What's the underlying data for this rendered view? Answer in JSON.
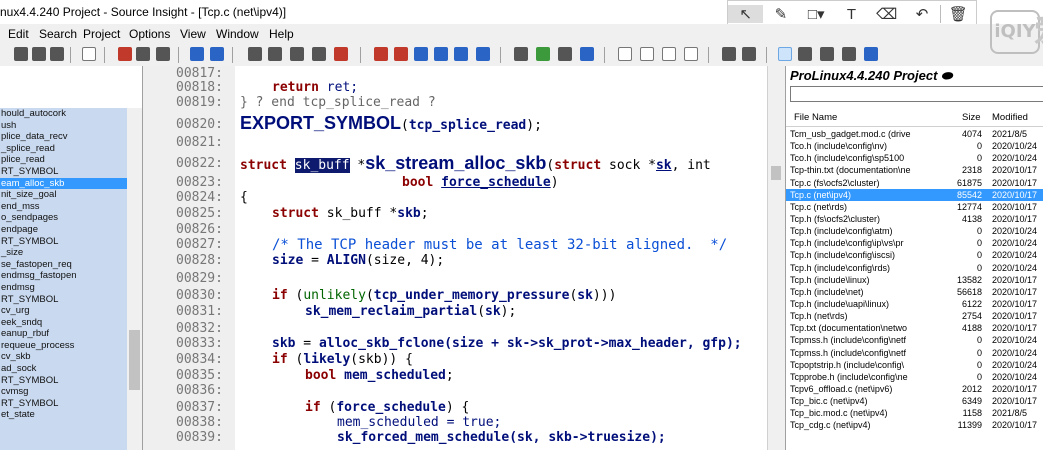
{
  "window": {
    "title": "nux4.4.240 Project - Source Insight - [Tcp.c (net\\ipv4)]"
  },
  "overlay_toolbar": {
    "icons": [
      "cursor-icon",
      "pen-icon",
      "rect-icon",
      "text-icon",
      "eraser-icon",
      "undo-icon",
      "trash-icon"
    ]
  },
  "watermark": {
    "text": "iQIY",
    "char": "爱"
  },
  "menu": {
    "items": [
      "Edit",
      "Search",
      "Project",
      "Options",
      "View",
      "Window",
      "Help"
    ]
  },
  "symbols": {
    "items": [
      "hould_autocork",
      "ush",
      "plice_data_recv",
      "_splice_read",
      "plice_read",
      "RT_SYMBOL",
      "eam_alloc_skb",
      "nit_size_goal",
      "end_mss",
      "o_sendpages",
      "endpage",
      "RT_SYMBOL",
      "_size",
      "se_fastopen_req",
      "endmsg_fastopen",
      "endmsg",
      "RT_SYMBOL",
      "cv_urg",
      "eek_sndq",
      "eanup_rbuf",
      "requeue_process",
      "cv_skb",
      "ad_sock",
      "RT_SYMBOL",
      "cvmsg",
      "RT_SYMBOL",
      "et_state"
    ],
    "selected_index": 6
  },
  "editor": {
    "line_numbers": [
      "00817:",
      "00818:",
      "00819:",
      "00820:",
      "00821:",
      "00822:",
      "00823:",
      "00824:",
      "00825:",
      "00826:",
      "00827:",
      "00828:",
      "00829:",
      "00830:",
      "00831:",
      "00832:",
      "00833:",
      "00834:",
      "00835:",
      "00836:",
      "00837:",
      "00838:",
      "00839:"
    ],
    "l818": {
      "kw": "return",
      "rest": " ret;"
    },
    "l819": {
      "text": "} ? end tcp_splice_read ?"
    },
    "l820": {
      "fn": "EXPORT_SYMBOL",
      "p1": "(",
      "arg": "tcp_splice_read",
      "p2": ");"
    },
    "l822": {
      "kw": "struct",
      "hl": "sk_buff",
      "star": " *",
      "fn": "sk_stream_alloc_skb",
      "p1": "(",
      "kw2": "struct",
      "sock": " sock *",
      "sk": "sk",
      "rest": ", int"
    },
    "l823": {
      "kw": "bool",
      "arg": "force_schedule",
      "p": ")"
    },
    "l824": {
      "text": "{"
    },
    "l825": {
      "kw": "struct",
      "rest": " sk_buff *",
      "id": "skb",
      "semi": ";"
    },
    "l827": {
      "text": "/* The TCP header must be at least 32-bit aligned.  */"
    },
    "l828": {
      "id": "size",
      "eq": " = ",
      "pr": "ALIGN",
      "args": "(size, 4);"
    },
    "l830": {
      "kw": "if",
      "p1": " (",
      "pr": "unlikely",
      "p2": "(",
      "fn": "tcp_under_memory_pressure",
      "args": "(",
      "sk": "sk",
      "end": ")))"
    },
    "l831": {
      "fn": "sk_mem_reclaim_partial",
      "p": "(",
      "sk": "sk",
      "end": ");"
    },
    "l833": {
      "id": "skb",
      "eq": " = ",
      "fn": "alloc_skb_fclone",
      "args": "(size + sk->sk_prot->max_header, gfp);"
    },
    "l834": {
      "kw": "if",
      "p1": " (",
      "pr": "likely",
      "args": "(skb)) {"
    },
    "l835": {
      "kw": "bool",
      "id": " mem_scheduled",
      "semi": ";"
    },
    "l837": {
      "kw": "if",
      "p1": " (",
      "id": "force_schedule",
      "end": ") {"
    },
    "l838": {
      "text": "mem_scheduled = true;"
    },
    "l839": {
      "fn": "sk_forced_mem_schedule",
      "args": "(sk, skb->truesize);"
    }
  },
  "project": {
    "title": "ProLinux4.4.240 Project",
    "columns": [
      "File Name",
      "Size",
      "Modified"
    ],
    "selected_index": 6,
    "files": [
      {
        "name": "Tcm_usb_gadget.mod.c (drive",
        "size": "4074",
        "date": "2021/8/5"
      },
      {
        "name": "Tco.h (include\\config\\nv)",
        "size": "0",
        "date": "2020/10/24"
      },
      {
        "name": "Tco.h (include\\config\\sp5100",
        "size": "0",
        "date": "2020/10/24"
      },
      {
        "name": "Tcp-thin.txt (documentation\\ne",
        "size": "2318",
        "date": "2020/10/17"
      },
      {
        "name": "Tcp.c (fs\\ocfs2\\cluster)",
        "size": "61875",
        "date": "2020/10/17"
      },
      {
        "name": "Tcp.c (net\\ipv4)",
        "size": "85542",
        "date": "2020/10/17"
      },
      {
        "name": "Tcp.c (net\\rds)",
        "size": "12774",
        "date": "2020/10/17"
      },
      {
        "name": "Tcp.h (fs\\ocfs2\\cluster)",
        "size": "4138",
        "date": "2020/10/17"
      },
      {
        "name": "Tcp.h (include\\config\\atm)",
        "size": "0",
        "date": "2020/10/24"
      },
      {
        "name": "Tcp.h (include\\config\\ip\\vs\\pr",
        "size": "0",
        "date": "2020/10/24"
      },
      {
        "name": "Tcp.h (include\\config\\iscsi)",
        "size": "0",
        "date": "2020/10/24"
      },
      {
        "name": "Tcp.h (include\\config\\rds)",
        "size": "0",
        "date": "2020/10/24"
      },
      {
        "name": "Tcp.h (include\\linux)",
        "size": "13582",
        "date": "2020/10/17"
      },
      {
        "name": "Tcp.h (include\\net)",
        "size": "56618",
        "date": "2020/10/17"
      },
      {
        "name": "Tcp.h (include\\uapi\\linux)",
        "size": "6122",
        "date": "2020/10/17"
      },
      {
        "name": "Tcp.h (net\\rds)",
        "size": "2754",
        "date": "2020/10/17"
      },
      {
        "name": "Tcp.txt (documentation\\netwo",
        "size": "4188",
        "date": "2020/10/17"
      },
      {
        "name": "Tcpmss.h (include\\config\\netf",
        "size": "0",
        "date": "2020/10/24"
      },
      {
        "name": "Tcpmss.h (include\\config\\netf",
        "size": "0",
        "date": "2020/10/24"
      },
      {
        "name": "Tcpoptstrip.h (include\\config\\",
        "size": "0",
        "date": "2020/10/24"
      },
      {
        "name": "Tcpprobe.h (include\\config\\ne",
        "size": "0",
        "date": "2020/10/24"
      },
      {
        "name": "Tcpv6_offload.c (net\\ipv6)",
        "size": "2012",
        "date": "2020/10/17"
      },
      {
        "name": "Tcp_bic.c (net\\ipv4)",
        "size": "6349",
        "date": "2020/10/17"
      },
      {
        "name": "Tcp_bic.mod.c (net\\ipv4)",
        "size": "1158",
        "date": "2021/8/5"
      },
      {
        "name": "Tcp_cdg.c (net\\ipv4)",
        "size": "11399",
        "date": "2020/10/17"
      }
    ]
  }
}
